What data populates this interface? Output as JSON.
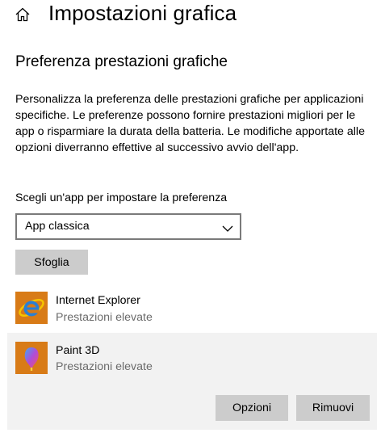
{
  "header": {
    "title": "Impostazioni grafica",
    "home_icon": "home-icon"
  },
  "section": {
    "title": "Preferenza prestazioni grafiche",
    "description": "Personalizza la preferenza delle prestazioni grafiche per applicazioni specifiche. Le preferenze possono fornire prestazioni migliori per le app o risparmiare la durata della batteria. Le modifiche apportate alle opzioni diverranno effettive al successivo avvio dell'app."
  },
  "chooser": {
    "label": "Scegli un'app per impostare la preferenza",
    "selected": "App classica",
    "chevron_icon": "chevron-down-icon",
    "browse_label": "Sfoglia"
  },
  "apps": [
    {
      "name": "Internet Explorer",
      "preference": "Prestazioni elevate",
      "icon": "internet-explorer-icon",
      "icon_bg": "#d87b17"
    },
    {
      "name": "Paint 3D",
      "preference": "Prestazioni elevate",
      "icon": "paint-3d-icon",
      "icon_bg": "#d87b17",
      "selected": true
    }
  ],
  "actions": {
    "options_label": "Opzioni",
    "remove_label": "Rimuovi"
  },
  "colors": {
    "accent_tile": "#d87b17",
    "button_grey": "#cccccc",
    "selected_row": "#f2f2f2",
    "secondary_text": "#6b6b6b"
  }
}
